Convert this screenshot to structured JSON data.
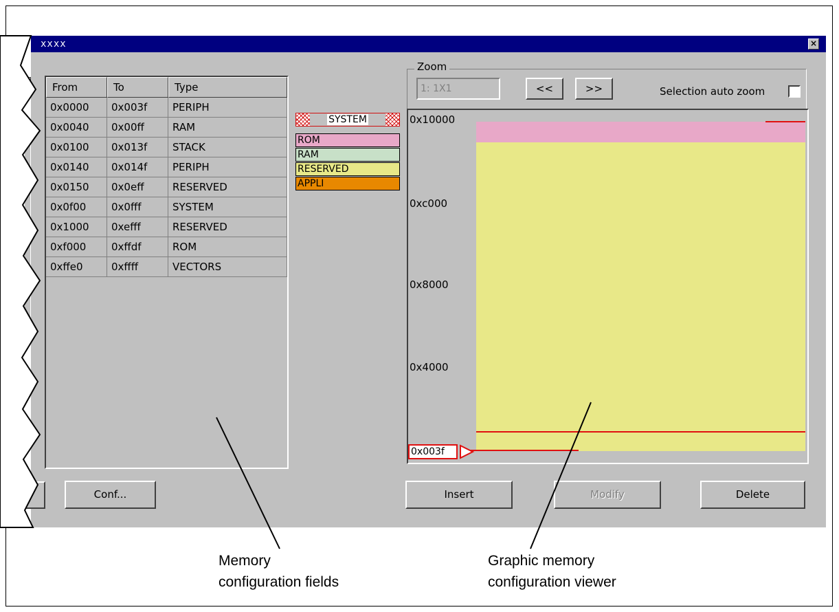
{
  "window": {
    "title": "xxxx",
    "close_icon": "close-icon"
  },
  "table": {
    "headers": [
      "From",
      "To",
      "Type"
    ],
    "rows": [
      [
        "0x0000",
        "0x003f",
        "PERIPH"
      ],
      [
        "0x0040",
        "0x00ff",
        "RAM"
      ],
      [
        "0x0100",
        "0x013f",
        "STACK"
      ],
      [
        "0x0140",
        "0x014f",
        "PERIPH"
      ],
      [
        "0x0150",
        "0x0eff",
        "RESERVED"
      ],
      [
        "0x0f00",
        "0x0fff",
        "SYSTEM"
      ],
      [
        "0x1000",
        "0xefff",
        "RESERVED"
      ],
      [
        "0xf000",
        "0xffdf",
        "ROM"
      ],
      [
        "0xffe0",
        "0xffff",
        "VECTORS"
      ]
    ]
  },
  "legend": {
    "items": [
      {
        "label": "SYSTEM",
        "color": "#ffffff",
        "style": "hatched"
      },
      {
        "label": "ROM",
        "color": "#e8a8c8"
      },
      {
        "label": "RAM",
        "color": "#c8e0c8"
      },
      {
        "label": "RESERVED",
        "color": "#e8e888"
      },
      {
        "label": "APPLI",
        "color": "#e88800"
      }
    ]
  },
  "zoom": {
    "group_label": "Zoom",
    "value": "1: 1X1",
    "prev_label": "<<",
    "next_label": ">>",
    "auto_zoom_label": "Selection auto zoom",
    "auto_zoom_checked": false
  },
  "viewer": {
    "y_labels": [
      "0x10000",
      "0xc000",
      "0x8000",
      "0x4000"
    ],
    "marker_label": "0x003f"
  },
  "buttons": {
    "conf": "Conf...",
    "insert": "Insert",
    "modify": "Modify",
    "delete": "Delete"
  },
  "annotations": {
    "left": [
      "Memory",
      "configuration fields"
    ],
    "right": [
      "Graphic memory",
      "configuration viewer"
    ]
  }
}
